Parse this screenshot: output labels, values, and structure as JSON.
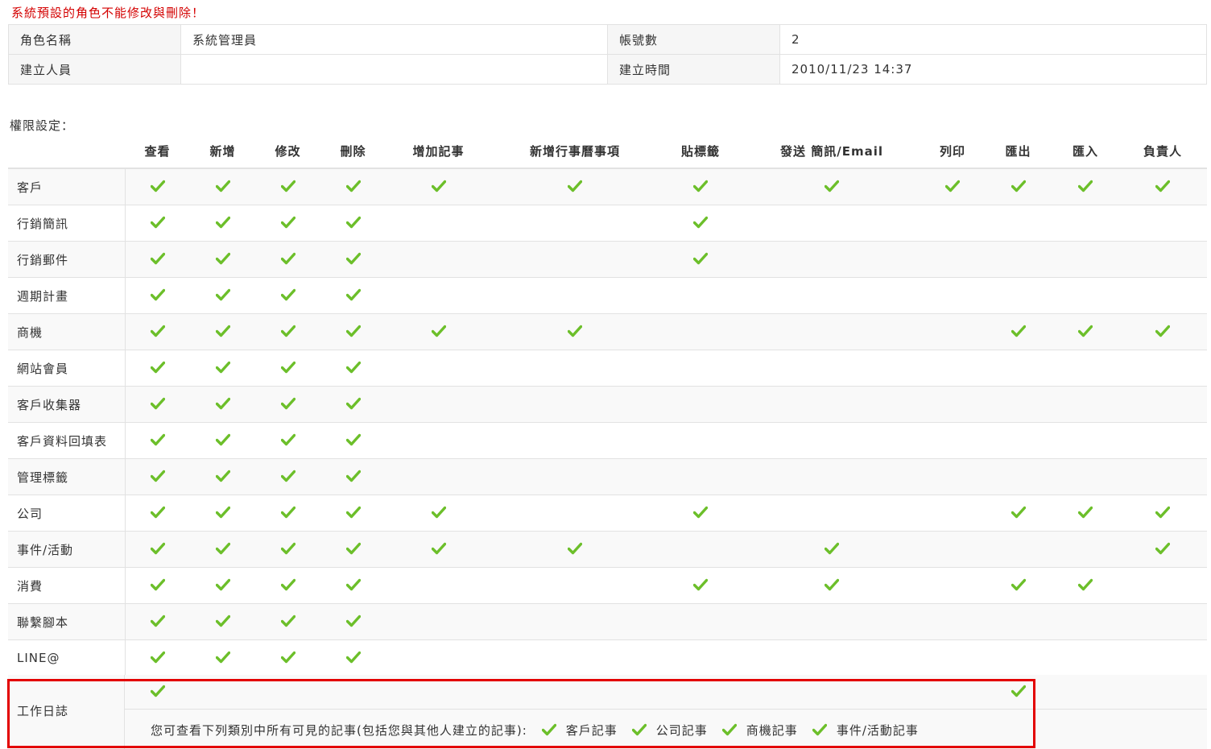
{
  "warning": "系統預設的角色不能修改與刪除！",
  "info": {
    "role_label": "角色名稱",
    "role_value": "系統管理員",
    "accounts_label": "帳號數",
    "accounts_value": "2",
    "creator_label": "建立人員",
    "creator_value": "",
    "created_label": "建立時間",
    "created_value": "2010/11/23 14:37"
  },
  "permission_title": "權限設定：",
  "columns": [
    "查看",
    "新增",
    "修改",
    "刪除",
    "增加記事",
    "新增行事曆事項",
    "貼標籤",
    "發送 簡訊/Email",
    "列印",
    "匯出",
    "匯入",
    "負責人"
  ],
  "rows": [
    {
      "name": "客戶",
      "checks": [
        1,
        1,
        1,
        1,
        1,
        1,
        1,
        1,
        1,
        1,
        1,
        1
      ]
    },
    {
      "name": "行銷簡訊",
      "checks": [
        1,
        1,
        1,
        1,
        0,
        0,
        1,
        0,
        0,
        0,
        0,
        0
      ]
    },
    {
      "name": "行銷郵件",
      "checks": [
        1,
        1,
        1,
        1,
        0,
        0,
        1,
        0,
        0,
        0,
        0,
        0
      ]
    },
    {
      "name": "週期計畫",
      "checks": [
        1,
        1,
        1,
        1,
        0,
        0,
        0,
        0,
        0,
        0,
        0,
        0
      ]
    },
    {
      "name": "商機",
      "checks": [
        1,
        1,
        1,
        1,
        1,
        1,
        0,
        0,
        0,
        1,
        1,
        1
      ]
    },
    {
      "name": "網站會員",
      "checks": [
        1,
        1,
        1,
        1,
        0,
        0,
        0,
        0,
        0,
        0,
        0,
        0
      ]
    },
    {
      "name": "客戶收集器",
      "checks": [
        1,
        1,
        1,
        1,
        0,
        0,
        0,
        0,
        0,
        0,
        0,
        0
      ]
    },
    {
      "name": "客戶資料回填表",
      "checks": [
        1,
        1,
        1,
        1,
        0,
        0,
        0,
        0,
        0,
        0,
        0,
        0
      ]
    },
    {
      "name": "管理標籤",
      "checks": [
        1,
        1,
        1,
        1,
        0,
        0,
        0,
        0,
        0,
        0,
        0,
        0
      ]
    },
    {
      "name": "公司",
      "checks": [
        1,
        1,
        1,
        1,
        1,
        0,
        1,
        0,
        0,
        1,
        1,
        1
      ]
    },
    {
      "name": "事件/活動",
      "checks": [
        1,
        1,
        1,
        1,
        1,
        1,
        0,
        1,
        0,
        0,
        0,
        1
      ]
    },
    {
      "name": "消費",
      "checks": [
        1,
        1,
        1,
        1,
        0,
        0,
        1,
        1,
        0,
        1,
        1,
        0
      ]
    },
    {
      "name": "聯繫腳本",
      "checks": [
        1,
        1,
        1,
        1,
        0,
        0,
        0,
        0,
        0,
        0,
        0,
        0
      ]
    },
    {
      "name": "LINE@",
      "checks": [
        1,
        1,
        1,
        1,
        0,
        0,
        0,
        0,
        0,
        0,
        0,
        0
      ]
    }
  ],
  "worklog": {
    "name": "工作日誌",
    "note": "您可查看下列類別中所有可見的記事(包括您與其他人建立的記事):",
    "items": [
      "客戶記事",
      "公司記事",
      "商機記事",
      "事件/活動記事"
    ]
  },
  "colors": {
    "check": "#6cbf2a",
    "warning": "#d40000",
    "highlight_box": "#e30000"
  },
  "icons": {
    "check": "check-icon"
  }
}
